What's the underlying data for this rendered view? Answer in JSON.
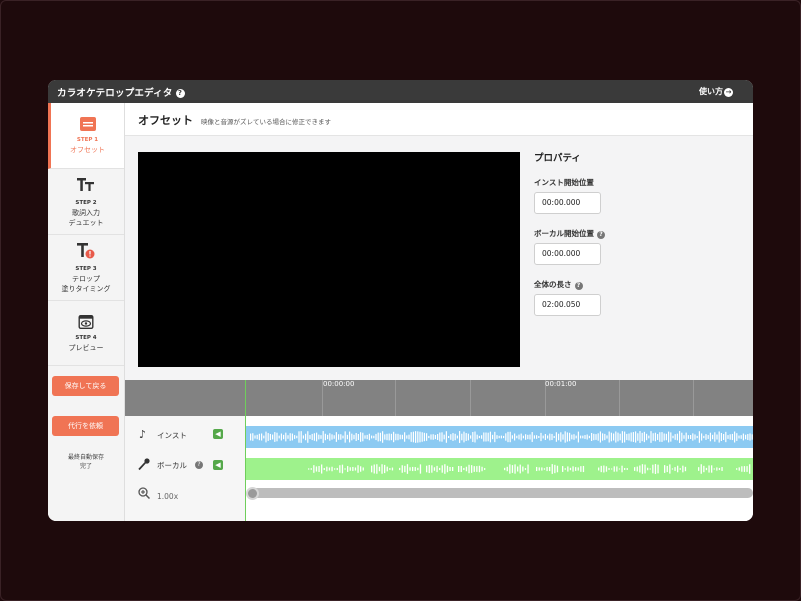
{
  "app": {
    "title": "カラオケテロップエディタ",
    "help_glyph": "?",
    "howto": "使い方",
    "howto_glyph": "→"
  },
  "sidebar": {
    "steps": [
      {
        "num": "STEP 1",
        "label_line1": "オフセット",
        "label_line2": "",
        "icon": "film-icon",
        "active": true
      },
      {
        "num": "STEP 2",
        "label_line1": "歌詞入力",
        "label_line2": "デュエット",
        "icon": "text-size-icon",
        "active": false
      },
      {
        "num": "STEP 3",
        "label_line1": "テロップ",
        "label_line2": "塗りタイミング",
        "icon": "text-timing-icon",
        "active": false
      },
      {
        "num": "STEP 4",
        "label_line1": "プレビュー",
        "label_line2": "",
        "icon": "preview-icon",
        "active": false
      }
    ],
    "save_back": "保存して戻る",
    "request": "代行を依頼",
    "autosave_line1": "最終自動保存",
    "autosave_line2": "完了"
  },
  "header": {
    "title": "オフセット",
    "desc": "映像と音源がズレている場合に修正できます"
  },
  "properties": {
    "title": "プロパティ",
    "inst_start_label": "インスト開始位置",
    "inst_start_value": "00:00.000",
    "vocal_start_label": "ボーカル開始位置",
    "vocal_start_value": "00:00.000",
    "total_length_label": "全体の長さ",
    "total_length_value": "02:00.050",
    "help_glyph": "?"
  },
  "timeline": {
    "ruler_labels": [
      "00:00:00",
      "00:01:00"
    ],
    "tracks": [
      {
        "name": "インスト",
        "icon": "music-note-icon",
        "color": "#8ccaf2"
      },
      {
        "name": "ボーカル",
        "icon": "microphone-icon",
        "color": "#9ef28c"
      }
    ],
    "zoom": "1.00x"
  },
  "colors": {
    "accent": "#f07454",
    "titlebar": "#3a3a3a",
    "speaker": "#55a84a"
  }
}
